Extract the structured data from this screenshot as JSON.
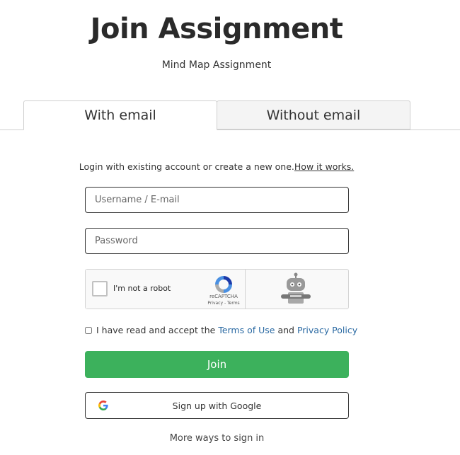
{
  "header": {
    "title": "Join Assignment",
    "subtitle": "Mind Map Assignment"
  },
  "tabs": [
    {
      "label": "With email",
      "active": true
    },
    {
      "label": "Without email",
      "active": false
    }
  ],
  "intro": {
    "text": "Login with existing account or create a new one.",
    "link": "How it works."
  },
  "form": {
    "username_placeholder": "Username / E-mail",
    "password_placeholder": "Password"
  },
  "captcha": {
    "label": "I'm not a robot",
    "brand": "reCAPTCHA",
    "links": "Privacy - Terms"
  },
  "terms": {
    "prefix": "I have read and accept the ",
    "terms_link": "Terms of Use",
    "and": " and ",
    "privacy_link": "Privacy Policy"
  },
  "buttons": {
    "join": "Join",
    "google": "Sign up with Google",
    "more": "More ways to sign in"
  },
  "colors": {
    "join_bg": "#3cb15c",
    "link": "#2b6aa3"
  }
}
